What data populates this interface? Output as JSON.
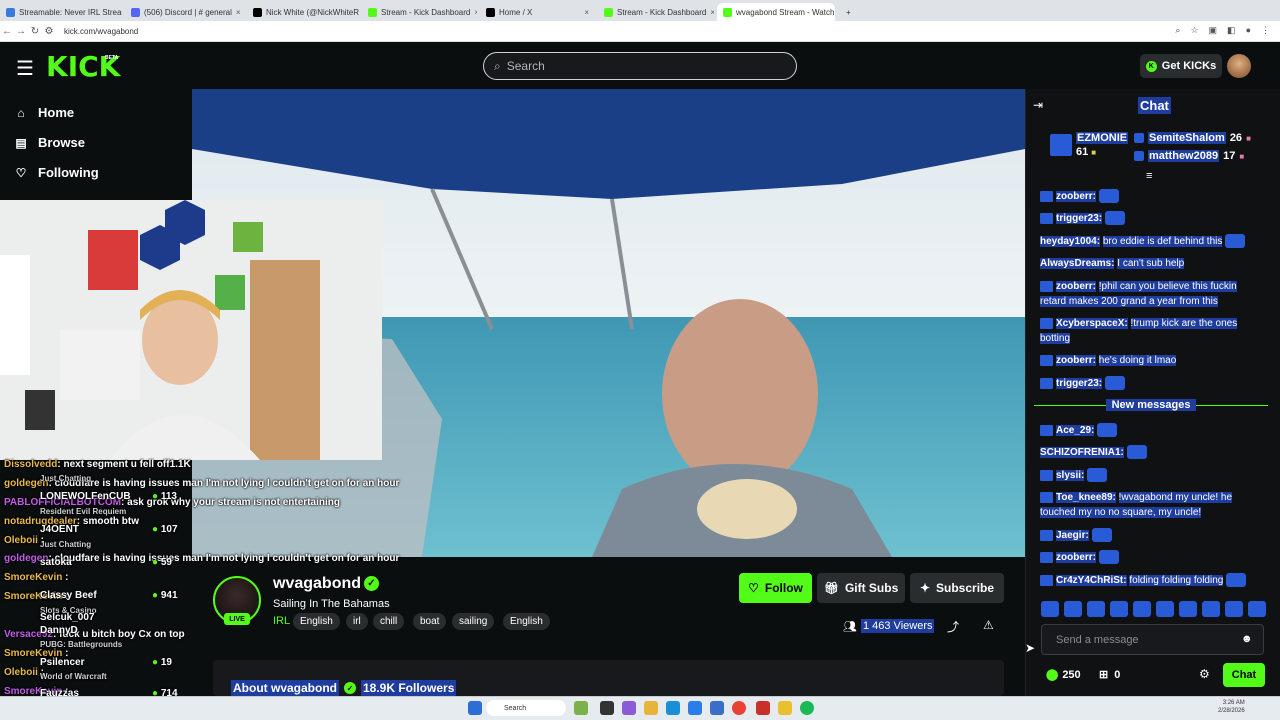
{
  "browser": {
    "tabs": [
      {
        "label": "Streamable: Never IRL Stream",
        "color": "#3c7bde"
      },
      {
        "label": "(506) Discord | # general",
        "color": "#5865f2"
      },
      {
        "label": "Nick White (@NickWhiteReal)",
        "color": "#000000"
      },
      {
        "label": "Stream - Kick Dashboard",
        "color": "#53fc18"
      },
      {
        "label": "Home / X",
        "color": "#000000"
      },
      {
        "label": "Stream - Kick Dashboard",
        "color": "#53fc18"
      },
      {
        "label": "wvagabond Stream - Watch Live",
        "color": "#53fc18"
      }
    ],
    "url": "kick.com/wvagabond"
  },
  "header": {
    "logo": "KICK",
    "beta": "BETA",
    "search_placeholder": "Search",
    "get_kicks": "Get KICKs"
  },
  "sidebar": {
    "items": [
      {
        "label": "Home",
        "icon": "home-icon"
      },
      {
        "label": "Browse",
        "icon": "browse-icon"
      },
      {
        "label": "Following",
        "icon": "heart-icon"
      }
    ]
  },
  "overlay_chat": [
    {
      "user": "Dissolvedd",
      "text": "next segment u fell off1.1K"
    },
    {
      "user": "goldegen",
      "text": "cloudfare is having issues man I'm not lying I couldn't get on for an hour"
    },
    {
      "user": "PABLOFFICIALBOTCOM",
      "text": "ask grok why your stream is not entertaining"
    },
    {
      "user": "notadrugdealer",
      "text": "smooth btw"
    },
    {
      "user": "Oleboii",
      "text": ""
    },
    {
      "user": "goldegen",
      "text": "cloudfare is having issues man I'm not lying I couldn't get on for an hour"
    },
    {
      "user": "SmoreKevin",
      "text": ""
    },
    {
      "user": "SmoreKevin",
      "text": ""
    },
    {
      "user": "Versace92",
      "text": "fuck u bitch boy Cx on top"
    },
    {
      "user": "SmoreKevin",
      "text": ""
    },
    {
      "user": "Oleboii",
      "text": ""
    },
    {
      "user": "SmoreKevin",
      "text": ""
    }
  ],
  "overlay_following": [
    {
      "name": "Just Chatting",
      "count": ""
    },
    {
      "name": "LONEWOLFenCUB",
      "count": "113"
    },
    {
      "name": "Resident Evil Requiem",
      "count": ""
    },
    {
      "name": "J4OENT",
      "count": "107"
    },
    {
      "name": "Just Chatting",
      "count": ""
    },
    {
      "name": "satoka",
      "count": "59"
    },
    {
      "name": "Classy Beef",
      "count": "941"
    },
    {
      "name": "Slots & Casino",
      "count": ""
    },
    {
      "name": "Selcuk_007",
      "count": ""
    },
    {
      "name": "DannyD",
      "count": ""
    },
    {
      "name": "PUBG: Battlegrounds",
      "count": ""
    },
    {
      "name": "Psilencer",
      "count": "19"
    },
    {
      "name": "World of Warcraft",
      "count": ""
    },
    {
      "name": "Fauzzas",
      "count": "714"
    }
  ],
  "stream": {
    "streamer": "wvagabond",
    "live": "LIVE",
    "title": "Sailing In The Bahamas",
    "category": "IRL",
    "tags": [
      "English",
      "irl",
      "chill",
      "boat",
      "sailing",
      "English"
    ],
    "follow": "Follow",
    "gift_subs": "Gift Subs",
    "subscribe": "Subscribe",
    "viewers": "1 463 Viewers",
    "about": "About wvagabond",
    "followers": "18.9K Followers"
  },
  "chat": {
    "title": "Chat",
    "gifters": [
      {
        "name": "EZMONIE",
        "count": "61"
      },
      {
        "name": "SemiteShalom",
        "count": "26"
      },
      {
        "name": "matthew2089",
        "count": "17"
      }
    ],
    "messages": [
      {
        "user": "zooberr:",
        "text": ""
      },
      {
        "user": "trigger23:",
        "text": ""
      },
      {
        "user": "heyday1004:",
        "text": "bro eddie is def behind this"
      },
      {
        "user": "AlwaysDreams:",
        "text": "I can't sub help"
      },
      {
        "user": "zooberr:",
        "text": "!phil can you believe this fuckin retard makes 200 grand a year from this"
      },
      {
        "user": "XcyberspaceX:",
        "text": "!trump kick are the ones botting"
      },
      {
        "user": "zooberr:",
        "text": "he's doing it lmao"
      },
      {
        "user": "trigger23:",
        "text": ""
      }
    ],
    "new_messages": "New messages",
    "messages_after": [
      {
        "user": "Ace_29:",
        "text": ""
      },
      {
        "user": "SCHIZOFRENIA1:",
        "text": ""
      },
      {
        "user": "slysii:",
        "text": ""
      },
      {
        "user": "Toe_knee89:",
        "text": "!wvagabond my uncle! he touched my no no square, my uncle!"
      },
      {
        "user": "Jaegir:",
        "text": ""
      },
      {
        "user": "zooberr:",
        "text": ""
      },
      {
        "user": "Cr4zY4ChRiSt:",
        "text": "folding folding folding"
      }
    ],
    "send_placeholder": "Send a message",
    "points": "250",
    "gift_count": "0",
    "chat_button": "Chat"
  },
  "taskbar": {
    "search": "Search",
    "time": "3:26 AM",
    "date": "2/28/2026"
  },
  "colors": {
    "kick_green": "#53fc18",
    "selection_blue": "#1f3d9e",
    "background": "#0b0e0f"
  }
}
